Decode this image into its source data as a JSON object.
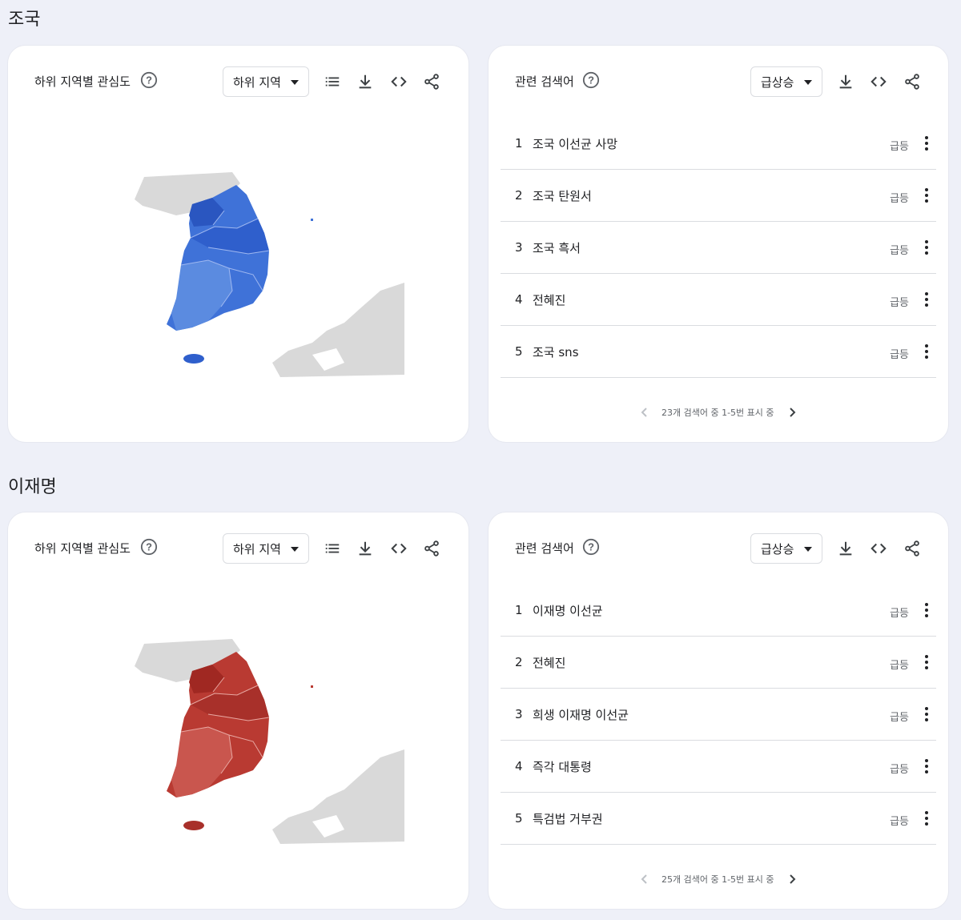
{
  "colors": {
    "background": "#eef0f8",
    "map_blue_dark": "#2f5fcc",
    "map_blue_mid": "#3f72d8",
    "map_blue_light": "#5b8be0",
    "map_red_dark": "#a8302a",
    "map_red_mid": "#b93a32",
    "map_red_light": "#c9564e",
    "land_gray": "#d9d9d9"
  },
  "sections": [
    {
      "title": "조국",
      "map_card": {
        "title": "하위 지역별 관심도",
        "dropdown": "하위 지역",
        "icons": [
          "help-icon",
          "list-icon",
          "download-icon",
          "embed-icon",
          "share-icon"
        ]
      },
      "queries_card": {
        "title": "관련 검색어",
        "dropdown": "급상승",
        "icons": [
          "help-icon",
          "download-icon",
          "embed-icon",
          "share-icon"
        ],
        "rows": [
          {
            "num": "1",
            "term": "조국 이선균 사망",
            "badge": "급등"
          },
          {
            "num": "2",
            "term": "조국 탄원서",
            "badge": "급등"
          },
          {
            "num": "3",
            "term": "조국 흑서",
            "badge": "급등"
          },
          {
            "num": "4",
            "term": "전혜진",
            "badge": "급등"
          },
          {
            "num": "5",
            "term": "조국 sns",
            "badge": "급등"
          }
        ],
        "pager": "23개 검색어 중 1-5번 표시 중"
      }
    },
    {
      "title": "이재명",
      "map_card": {
        "title": "하위 지역별 관심도",
        "dropdown": "하위 지역",
        "icons": [
          "help-icon",
          "list-icon",
          "download-icon",
          "embed-icon",
          "share-icon"
        ]
      },
      "queries_card": {
        "title": "관련 검색어",
        "dropdown": "급상승",
        "icons": [
          "help-icon",
          "download-icon",
          "embed-icon",
          "share-icon"
        ],
        "rows": [
          {
            "num": "1",
            "term": "이재명 이선균",
            "badge": "급등"
          },
          {
            "num": "2",
            "term": "전혜진",
            "badge": "급등"
          },
          {
            "num": "3",
            "term": "희생 이재명 이선균",
            "badge": "급등"
          },
          {
            "num": "4",
            "term": "즉각 대통령",
            "badge": "급등"
          },
          {
            "num": "5",
            "term": "특검법 거부권",
            "badge": "급등"
          }
        ],
        "pager": "25개 검색어 중 1-5번 표시 중"
      }
    }
  ]
}
